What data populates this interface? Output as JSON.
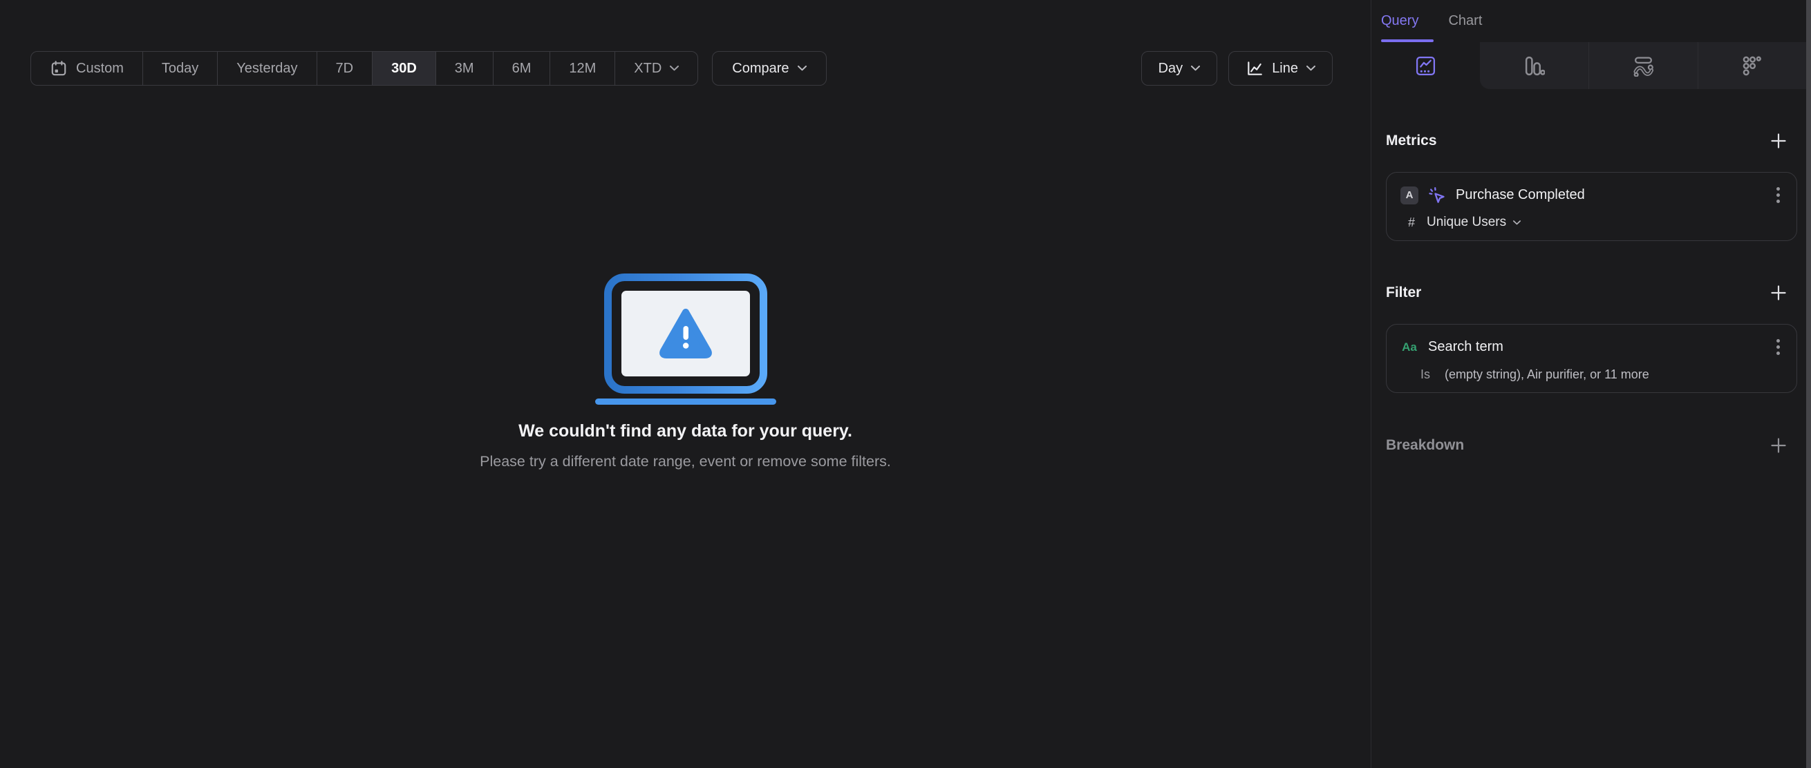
{
  "colors": {
    "accent_purple": "#7c6ff0",
    "event_purple": "#8075f2",
    "string_green": "#35a171",
    "alert_blue": "#3d8ce2",
    "laptop_blue_dark": "#2b74c9",
    "laptop_blue_light": "#5aa9f8"
  },
  "toolbar": {
    "segments": [
      "Custom",
      "Today",
      "Yesterday",
      "7D",
      "30D",
      "3M",
      "6M",
      "12M",
      "XTD"
    ],
    "selected_segment": "30D",
    "compare_label": "Compare",
    "granularity_label": "Day",
    "chart_type_label": "Line"
  },
  "empty_state": {
    "title": "We couldn't find any data for your query.",
    "subtitle": "Please try a different date range, event or remove some filters."
  },
  "sidebar": {
    "tabs": {
      "query": "Query",
      "chart": "Chart",
      "active": "Query"
    },
    "metrics": {
      "heading": "Metrics",
      "event_letter": "A",
      "event_name": "Purchase Completed",
      "aggregation_symbol": "#",
      "aggregation_label": "Unique Users"
    },
    "filter": {
      "heading": "Filter",
      "type_badge": "Aa",
      "property_name": "Search term",
      "operator": "Is",
      "values_summary": "(empty string), Air purifier, or 11 more"
    },
    "breakdown": {
      "heading": "Breakdown"
    }
  }
}
